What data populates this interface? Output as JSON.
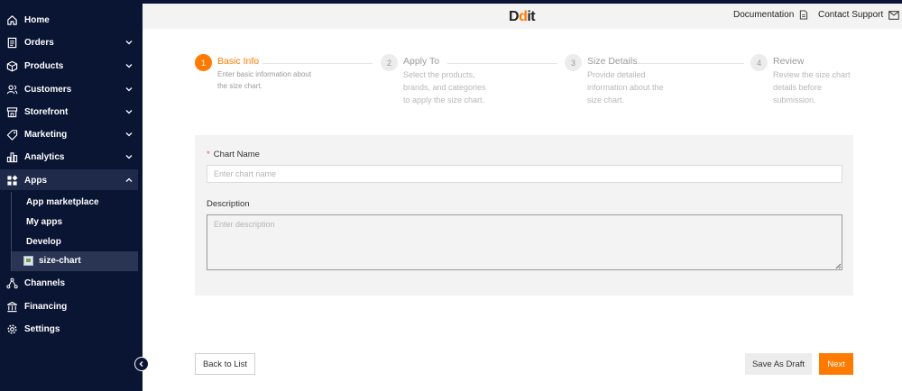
{
  "sidebar": {
    "items": [
      {
        "label": "Home",
        "icon": "home-icon"
      },
      {
        "label": "Orders",
        "icon": "orders-icon"
      },
      {
        "label": "Products",
        "icon": "products-icon"
      },
      {
        "label": "Customers",
        "icon": "customers-icon"
      },
      {
        "label": "Storefront",
        "icon": "storefront-icon"
      },
      {
        "label": "Marketing",
        "icon": "marketing-icon"
      },
      {
        "label": "Analytics",
        "icon": "analytics-icon"
      },
      {
        "label": "Apps",
        "icon": "apps-icon"
      },
      {
        "label": "Channels",
        "icon": "channels-icon"
      },
      {
        "label": "Financing",
        "icon": "financing-icon"
      },
      {
        "label": "Settings",
        "icon": "settings-icon"
      }
    ],
    "apps_sub": [
      "App marketplace",
      "My apps",
      "Develop",
      "size-chart"
    ]
  },
  "header": {
    "logo": {
      "part1": "D",
      "dot": "d",
      "part2": "it"
    },
    "documentation": "Documentation",
    "contact": "Contact Support"
  },
  "steps": [
    {
      "num": "1",
      "title": "Basic Info",
      "desc": "Enter basic information about the size chart.",
      "active": true
    },
    {
      "num": "2",
      "title": "Apply To",
      "desc": "Select the products, brands, and categories to apply the size chart.",
      "active": false
    },
    {
      "num": "3",
      "title": "Size Details",
      "desc": "Provide detailed information about the size chart.",
      "active": false
    },
    {
      "num": "4",
      "title": "Review",
      "desc": "Review the size chart details before submission.",
      "active": false
    }
  ],
  "form": {
    "required_mark": "*",
    "chart_name_label": "Chart Name",
    "chart_name_placeholder": "Enter chart name",
    "chart_name_value": "",
    "description_label": "Description",
    "description_placeholder": "Enter description",
    "description_value": ""
  },
  "footer": {
    "back_label": "Back to List",
    "draft_label": "Save As Draft",
    "next_label": "Next"
  },
  "colors": {
    "sidebar_bg": "#0a1433",
    "accent": "#ff7a00",
    "panel_bg": "#f3f3f3"
  }
}
